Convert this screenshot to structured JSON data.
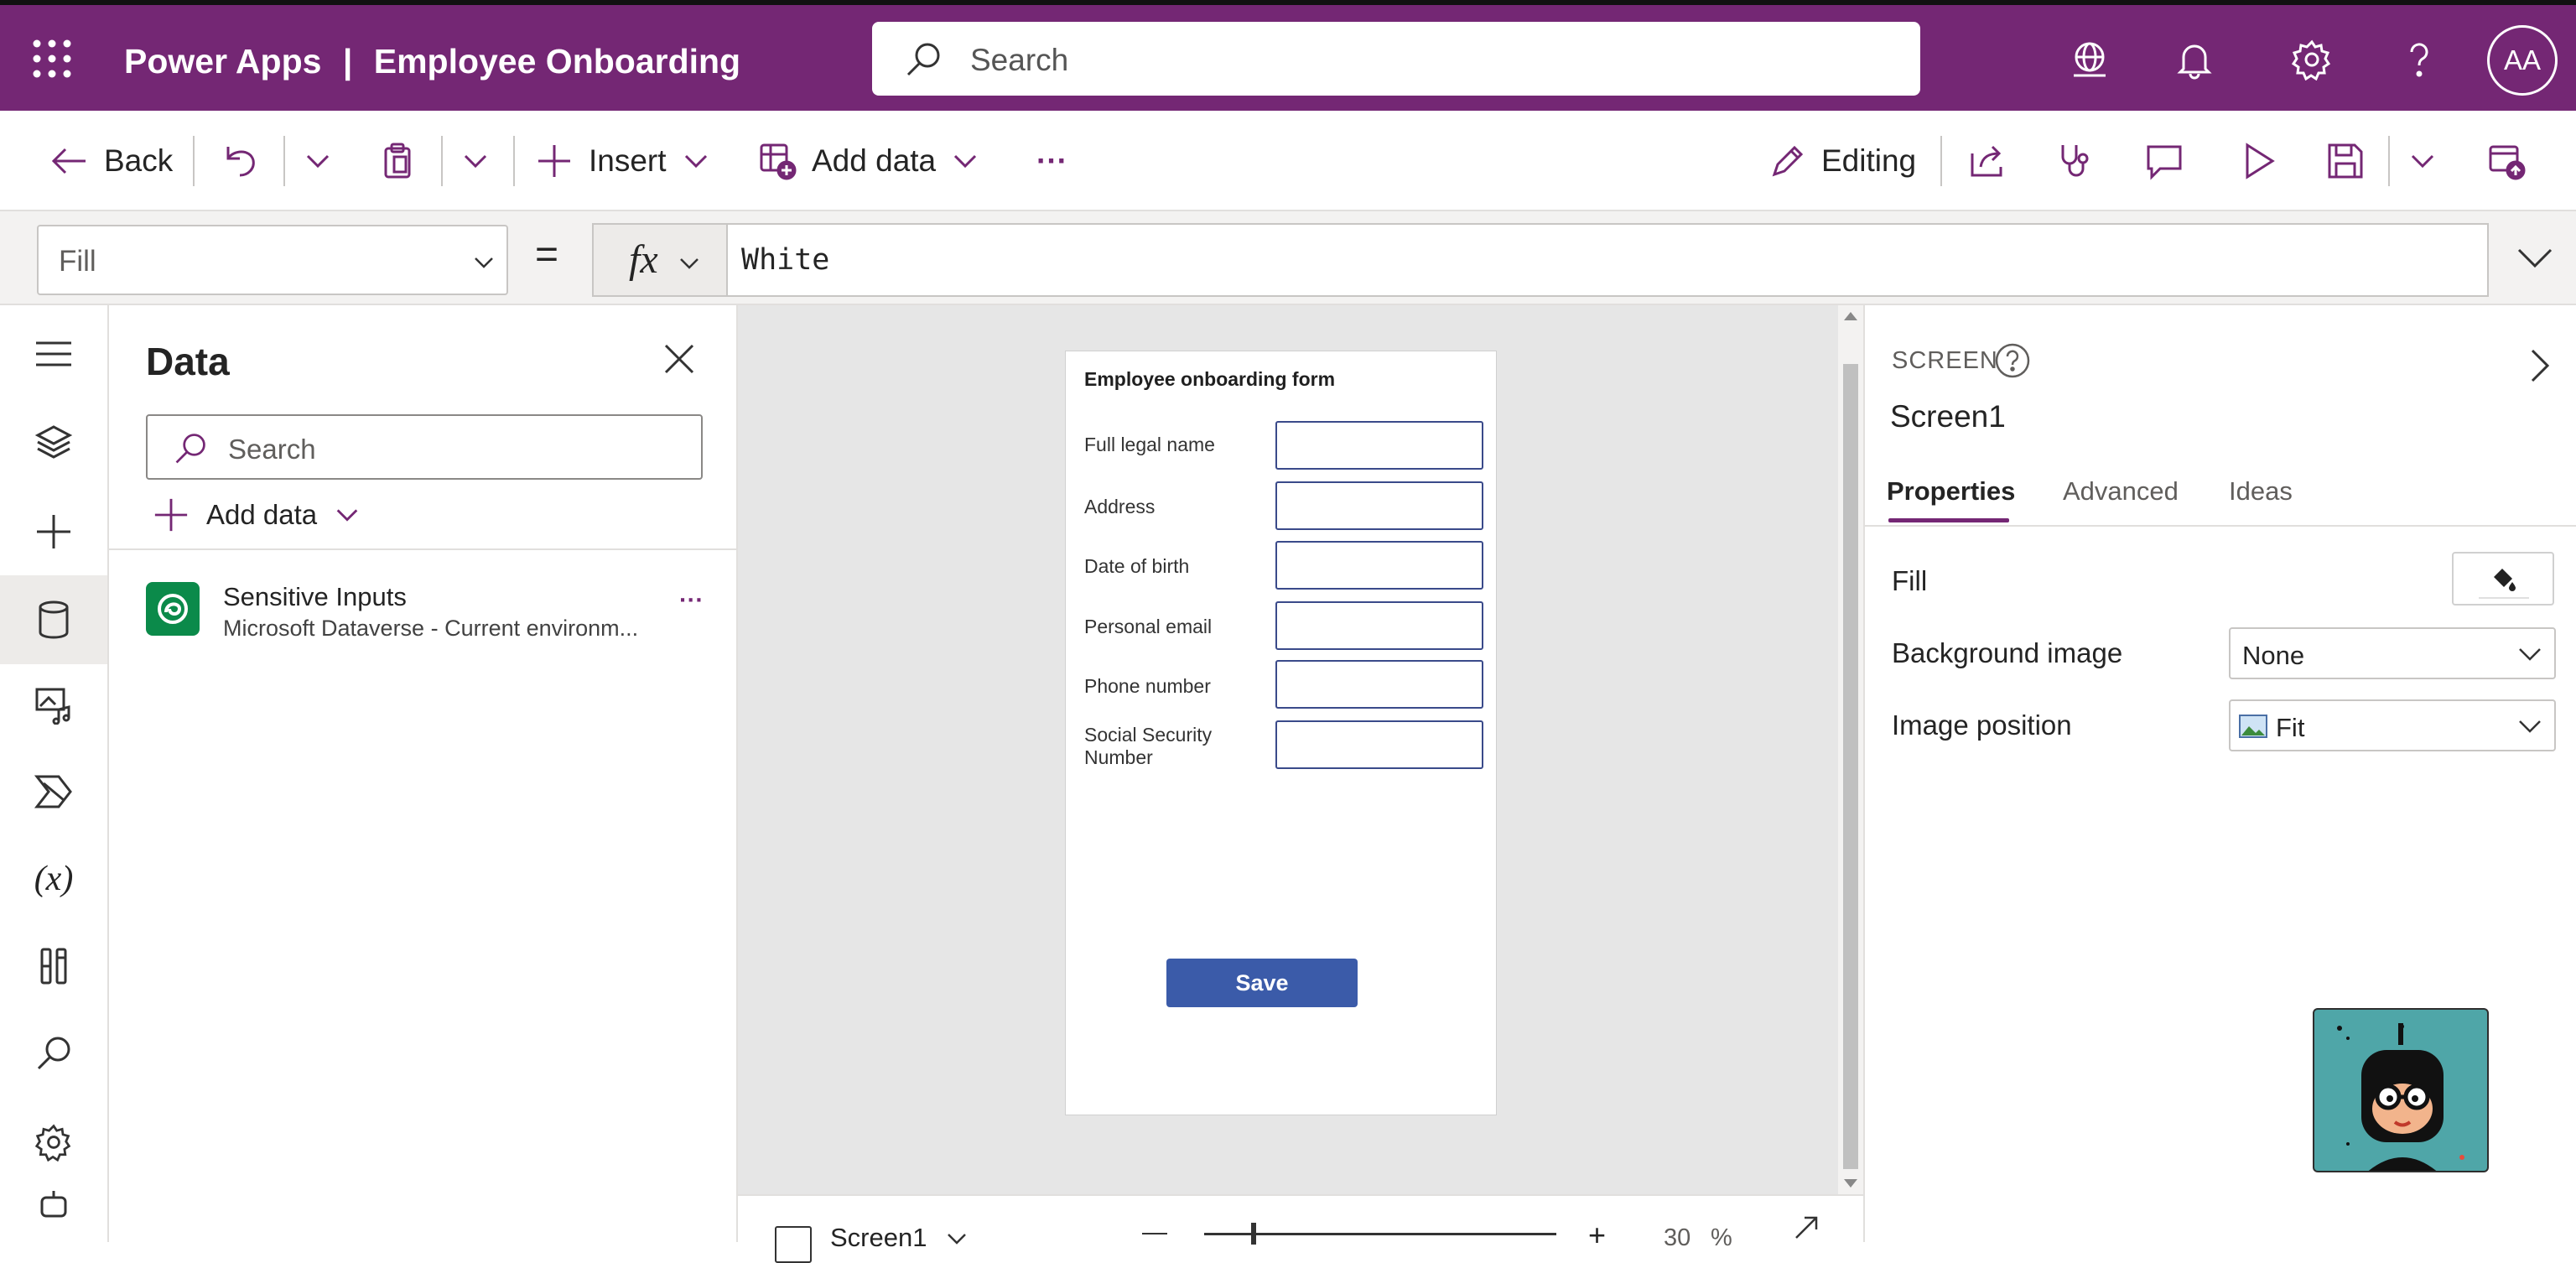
{
  "header": {
    "app_name": "Power Apps",
    "separator": "|",
    "app_title": "Employee Onboarding",
    "search_placeholder": "Search",
    "avatar_initials": "AA"
  },
  "commandbar": {
    "back_label": "Back",
    "insert_label": "Insert",
    "add_data_label": "Add data",
    "more_label": "···",
    "editing_label": "Editing"
  },
  "formula": {
    "property": "Fill",
    "equals": "=",
    "fx": "fx",
    "value": "White"
  },
  "data_pane": {
    "title": "Data",
    "search_placeholder": "Search",
    "add_data_label": "Add data",
    "source_name": "Sensitive Inputs",
    "source_desc": "Microsoft Dataverse - Current environm...",
    "more": "···"
  },
  "form": {
    "title": "Employee onboarding form",
    "fields": [
      {
        "label": "Full legal name"
      },
      {
        "label": "Address"
      },
      {
        "label": "Date of birth"
      },
      {
        "label": "Personal email"
      },
      {
        "label": "Phone number"
      },
      {
        "label": "Social Security Number"
      }
    ],
    "save_label": "Save"
  },
  "bottom": {
    "screen_label": "Screen1",
    "zoom_value": "30",
    "zoom_unit": "%"
  },
  "right_pane": {
    "section_label": "SCREEN",
    "screen_name": "Screen1",
    "tabs": [
      "Properties",
      "Advanced",
      "Ideas"
    ],
    "fill_label": "Fill",
    "bg_image_label": "Background image",
    "bg_image_value": "None",
    "img_position_label": "Image position",
    "img_position_value": "Fit"
  },
  "colors": {
    "brand": "#742774",
    "save_button": "#3b5ba9",
    "input_border": "#3a4a8a"
  }
}
